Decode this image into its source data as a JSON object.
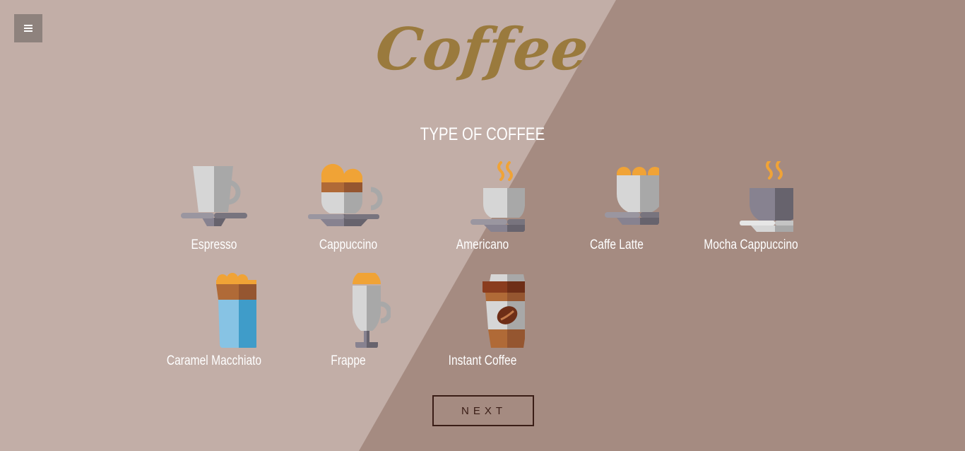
{
  "header": {
    "title": "Coffee",
    "menu_icon": "hamburger-icon"
  },
  "section": {
    "heading": "TYPE OF COFFEE"
  },
  "coffees": [
    {
      "label": "Espresso",
      "icon": "espresso-cup-icon"
    },
    {
      "label": "Cappuccino",
      "icon": "cappuccino-cup-icon"
    },
    {
      "label": "Americano",
      "icon": "americano-cup-icon"
    },
    {
      "label": "Caffe Latte",
      "icon": "latte-cup-icon"
    },
    {
      "label": "Mocha Cappuccino",
      "icon": "mocha-cup-icon"
    },
    {
      "label": "Caramel Macchiato",
      "icon": "macchiato-glass-icon"
    },
    {
      "label": "Frappe",
      "icon": "frappe-glass-icon"
    },
    {
      "label": "Instant Coffee",
      "icon": "takeaway-cup-icon"
    }
  ],
  "actions": {
    "next_label": "NEXT"
  },
  "colors": {
    "bg_light": "#c2aea7",
    "bg_dark": "#a58b81",
    "title": "#9a7a3d",
    "button_border": "#3a1d16"
  }
}
